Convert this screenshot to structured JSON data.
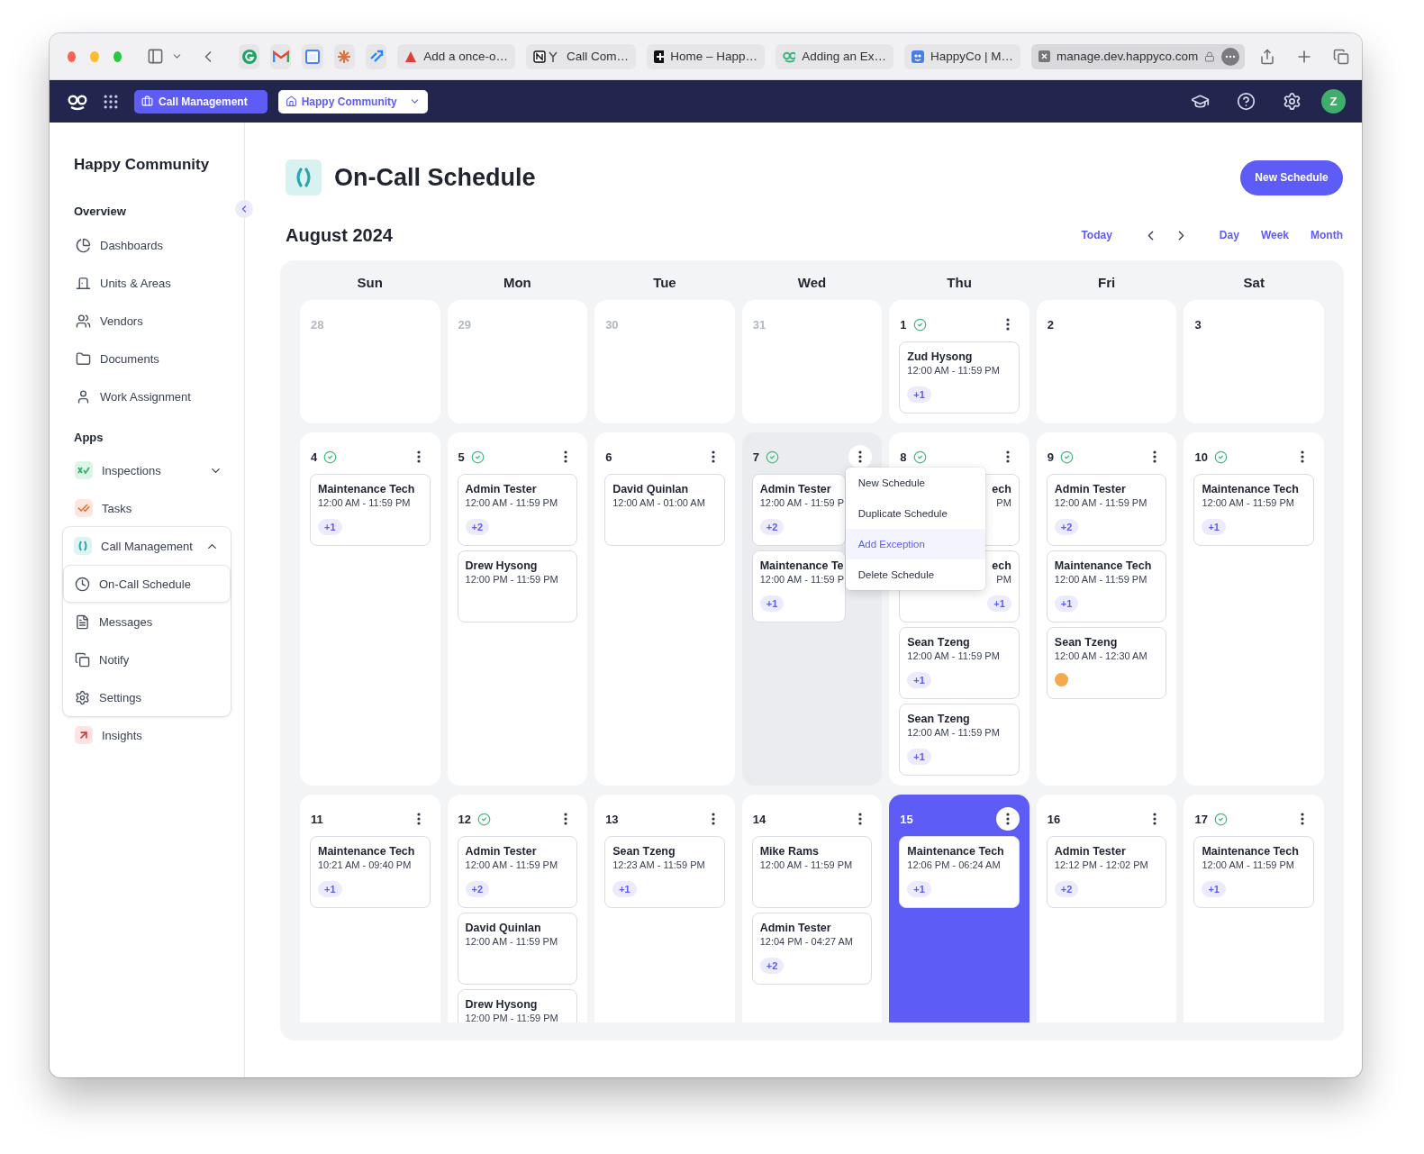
{
  "browser": {
    "tabs": [
      {
        "title": "Add a once-o…"
      },
      {
        "title": "Call Com…"
      },
      {
        "title": "Home – Happ…"
      },
      {
        "title": "Adding an Ex…"
      },
      {
        "title": "HappyCo | M…"
      }
    ],
    "address": "manage.dev.happyco.com"
  },
  "navbar": {
    "app_button": "Call Management",
    "community_button": "Happy Community",
    "avatar": "Z"
  },
  "sidebar": {
    "title": "Happy Community",
    "sections": [
      {
        "heading": "Overview",
        "items": [
          {
            "label": "Dashboards"
          },
          {
            "label": "Units & Areas"
          },
          {
            "label": "Vendors"
          },
          {
            "label": "Documents"
          },
          {
            "label": "Work Assignment"
          }
        ]
      },
      {
        "heading": "Apps",
        "items": [
          {
            "label": "Inspections",
            "expanded": false
          },
          {
            "label": "Tasks"
          },
          {
            "label": "Call Management",
            "expanded": true,
            "children": [
              {
                "label": "On-Call Schedule",
                "selected": true
              },
              {
                "label": "Messages",
                "selected": false
              },
              {
                "label": "Notify",
                "selected": false
              },
              {
                "label": "Settings",
                "selected": false
              }
            ]
          },
          {
            "label": "Insights"
          }
        ]
      }
    ]
  },
  "page": {
    "title": "On-Call Schedule",
    "new_button": "New Schedule",
    "month": "August 2024",
    "today_button": "Today",
    "views": [
      "Day",
      "Week",
      "Month"
    ]
  },
  "calendar": {
    "weekdays": [
      "Sun",
      "Mon",
      "Tue",
      "Wed",
      "Thu",
      "Fri",
      "Sat"
    ],
    "weeks": [
      {
        "days": [
          {
            "number": "28",
            "muted": true
          },
          {
            "number": "29",
            "muted": true
          },
          {
            "number": "30",
            "muted": true
          },
          {
            "number": "31",
            "muted": true
          },
          {
            "number": "1",
            "checked": true,
            "actions": true,
            "cards": [
              {
                "name": "Zud Hysong",
                "time": "12:00 AM - 11:59 PM",
                "badge": "+1"
              }
            ]
          },
          {
            "number": "2"
          },
          {
            "number": "3"
          }
        ]
      },
      {
        "days": [
          {
            "number": "4",
            "checked": true,
            "actions": true,
            "cards": [
              {
                "name": "Maintenance Tech",
                "time": "12:00 AM - 11:59 PM",
                "badge": "+1"
              }
            ]
          },
          {
            "number": "5",
            "checked": true,
            "actions": true,
            "cards": [
              {
                "name": "Admin Tester",
                "time": "12:00 AM - 11:59 PM",
                "badge": "+2"
              },
              {
                "name": "Drew Hysong",
                "time": "12:00 PM - 11:59 PM"
              }
            ]
          },
          {
            "number": "6",
            "actions": true,
            "cards": [
              {
                "name": "David Quinlan",
                "time": "12:00 AM - 01:00 AM"
              }
            ]
          },
          {
            "number": "7",
            "checked": true,
            "actions": true,
            "highlighted": true,
            "cards": [
              {
                "name": "Admin Tester",
                "time": "12:00 AM - 11:59 P",
                "badge": "+2"
              },
              {
                "name": "Maintenance Te",
                "time": "12:00 AM - 11:59 P",
                "badge": "+1"
              }
            ],
            "menu": [
              {
                "label": "New Schedule",
                "selected": false
              },
              {
                "label": "Duplicate Schedule",
                "selected": false
              },
              {
                "label": "Add Exception",
                "selected": true
              },
              {
                "label": "Delete Schedule",
                "selected": false
              }
            ]
          },
          {
            "number": "8",
            "checked": true,
            "actions": true,
            "cards": [
              {
                "name": "ech",
                "time": "PM",
                "covered": true
              },
              {
                "name": "ech",
                "time": "PM",
                "badge": "+1",
                "covered": true
              },
              {
                "name": "Sean Tzeng",
                "time": "12:00 AM - 11:59 PM",
                "badge": "+1"
              },
              {
                "name": "Sean Tzeng",
                "time": "12:00 AM - 11:59 PM",
                "badge": "+1"
              }
            ]
          },
          {
            "number": "9",
            "checked": true,
            "actions": true,
            "cards": [
              {
                "name": "Admin Tester",
                "time": "12:00 AM - 11:59 PM",
                "badge": "+2"
              },
              {
                "name": "Maintenance Tech",
                "time": "12:00 AM - 11:59 PM",
                "badge": "+1"
              },
              {
                "name": "Sean Tzeng",
                "time": "12:00 AM - 12:30 AM",
                "color": "#f5a94a"
              }
            ]
          },
          {
            "number": "10",
            "checked": true,
            "actions": true,
            "cards": [
              {
                "name": "Maintenance Tech",
                "time": "12:00 AM - 11:59 PM",
                "badge": "+1"
              }
            ]
          }
        ]
      },
      {
        "days": [
          {
            "number": "11",
            "actions": true,
            "cards": [
              {
                "name": "Maintenance Tech",
                "time": "10:21 AM - 09:40 PM",
                "badge": "+1"
              }
            ]
          },
          {
            "number": "12",
            "checked": true,
            "actions": true,
            "cards": [
              {
                "name": "Admin Tester",
                "time": "12:00 AM - 11:59 PM",
                "badge": "+2"
              },
              {
                "name": "David Quinlan",
                "time": "12:00 AM - 11:59 PM"
              },
              {
                "name": "Drew Hysong",
                "time": "12:00 PM - 11:59 PM"
              }
            ]
          },
          {
            "number": "13",
            "actions": true,
            "cards": [
              {
                "name": "Sean Tzeng",
                "time": "12:23 AM - 11:59 PM",
                "badge": "+1"
              }
            ]
          },
          {
            "number": "14",
            "actions": true,
            "cards": [
              {
                "name": "Mike Rams",
                "time": "12:00 AM - 11:59 PM"
              },
              {
                "name": "Admin Tester",
                "time": "12:04 PM - 04:27 AM",
                "badge": "+2"
              }
            ]
          },
          {
            "number": "15",
            "actions": true,
            "today": true,
            "cards": [
              {
                "name": "Maintenance Tech",
                "time": "12:06 PM - 06:24 AM",
                "badge": "+1"
              }
            ]
          },
          {
            "number": "16",
            "actions": true,
            "cards": [
              {
                "name": "Admin Tester",
                "time": "12:12 PM - 12:02 PM",
                "badge": "+2"
              }
            ]
          },
          {
            "number": "17",
            "checked": true,
            "actions": true,
            "cards": [
              {
                "name": "Maintenance Tech",
                "time": "12:00 AM - 11:59 PM",
                "badge": "+1"
              }
            ]
          }
        ]
      }
    ]
  }
}
